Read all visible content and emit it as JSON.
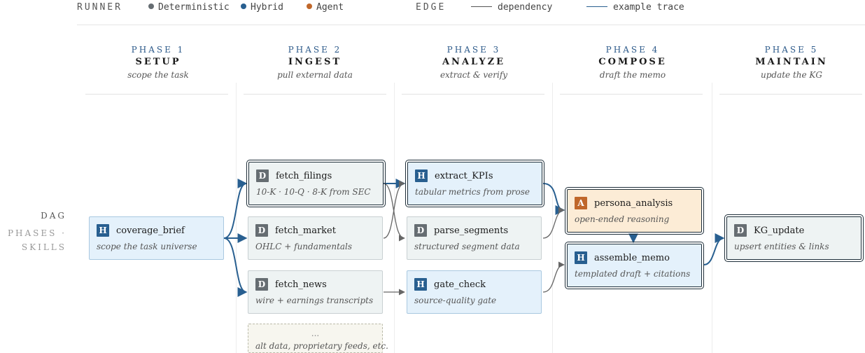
{
  "legend": {
    "runner_label": "RUNNER",
    "runners": [
      {
        "label": "Deterministic",
        "color": "#666d72"
      },
      {
        "label": "Hybrid",
        "color": "#285f90"
      },
      {
        "label": "Agent",
        "color": "#c0672a"
      }
    ],
    "edge_label": "EDGE",
    "edges": [
      {
        "label": "dependency",
        "color": "#555555"
      },
      {
        "label": "example trace",
        "color": "#285f90"
      }
    ]
  },
  "side_label": {
    "dag": "DAG",
    "phases": "PHASES ·",
    "skills": "SKILLS"
  },
  "phases": [
    {
      "number": "PHASE 1",
      "title": "SETUP",
      "subtitle": "scope the task"
    },
    {
      "number": "PHASE 2",
      "title": "INGEST",
      "subtitle": "pull external data"
    },
    {
      "number": "PHASE 3",
      "title": "ANALYZE",
      "subtitle": "extract & verify"
    },
    {
      "number": "PHASE 4",
      "title": "COMPOSE",
      "subtitle": "draft the memo"
    },
    {
      "number": "PHASE 5",
      "title": "MAINTAIN",
      "subtitle": "update the KG"
    }
  ],
  "nodes": {
    "coverage_brief": {
      "badge": "H",
      "name": "coverage_brief",
      "desc": "scope the task universe"
    },
    "fetch_filings": {
      "badge": "D",
      "name": "fetch_filings",
      "desc": "10-K · 10-Q · 8-K from SEC"
    },
    "fetch_market": {
      "badge": "D",
      "name": "fetch_market",
      "desc": "OHLC + fundamentals"
    },
    "fetch_news": {
      "badge": "D",
      "name": "fetch_news",
      "desc": "wire + earnings transcripts"
    },
    "more_sources": {
      "dots": "...",
      "desc": "alt data, proprietary feeds, etc."
    },
    "extract_KPIs": {
      "badge": "H",
      "name": "extract_KPIs",
      "desc": "tabular metrics from prose"
    },
    "parse_segments": {
      "badge": "D",
      "name": "parse_segments",
      "desc": "structured segment data"
    },
    "gate_check": {
      "badge": "H",
      "name": "gate_check",
      "desc": "source-quality gate"
    },
    "persona_analysis": {
      "badge": "A",
      "name": "persona_analysis",
      "desc": "open-ended reasoning"
    },
    "assemble_memo": {
      "badge": "H",
      "name": "assemble_memo",
      "desc": "templated draft + citations"
    },
    "KG_update": {
      "badge": "D",
      "name": "KG_update",
      "desc": "upsert entities & links"
    }
  }
}
